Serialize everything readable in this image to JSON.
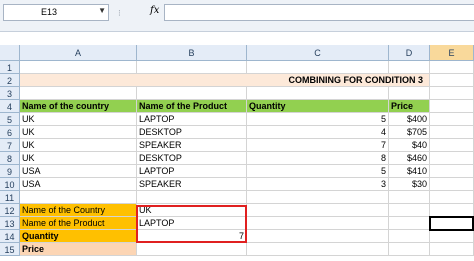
{
  "formula_bar": {
    "name_box": "E13",
    "name_dropdown": "▼",
    "separator": "⁝",
    "fx_label": "fx",
    "formula": ""
  },
  "columns": [
    "A",
    "B",
    "C",
    "D",
    "E"
  ],
  "selected_column": "E",
  "row_numbers": [
    "1",
    "2",
    "3",
    "4",
    "5",
    "6",
    "7",
    "8",
    "9",
    "10",
    "11",
    "12",
    "13",
    "14",
    "15"
  ],
  "title": "COMBINING FOR CONDITION 3",
  "table_headers": {
    "country": "Name of the country",
    "product": "Name of the Product",
    "quantity": "Quantity",
    "price": "Price"
  },
  "rows": [
    {
      "country": "UK",
      "product": "LAPTOP",
      "quantity": "5",
      "price": "$400"
    },
    {
      "country": "UK",
      "product": "DESKTOP",
      "quantity": "4",
      "price": "$705"
    },
    {
      "country": "UK",
      "product": "SPEAKER",
      "quantity": "7",
      "price": "$40"
    },
    {
      "country": "UK",
      "product": "DESKTOP",
      "quantity": "8",
      "price": "$460"
    },
    {
      "country": "USA",
      "product": "LAPTOP",
      "quantity": "5",
      "price": "$410"
    },
    {
      "country": "USA",
      "product": "SPEAKER",
      "quantity": "3",
      "price": "$30"
    }
  ],
  "criteria": {
    "country_label": "Name of the Country",
    "country_value": "UK",
    "product_label": "Name of the Product",
    "product_value": "LAPTOP",
    "quantity_label": "Quantity",
    "quantity_value": "7",
    "price_label": "Price",
    "price_value": ""
  },
  "colors": {
    "header_green": "#92d050",
    "title_band": "#fde9d9",
    "criteria_orange": "#ffc000",
    "price_peach": "#fcd5b4",
    "highlight_red": "#e02020",
    "selected_column_header": "#f9d99b"
  }
}
